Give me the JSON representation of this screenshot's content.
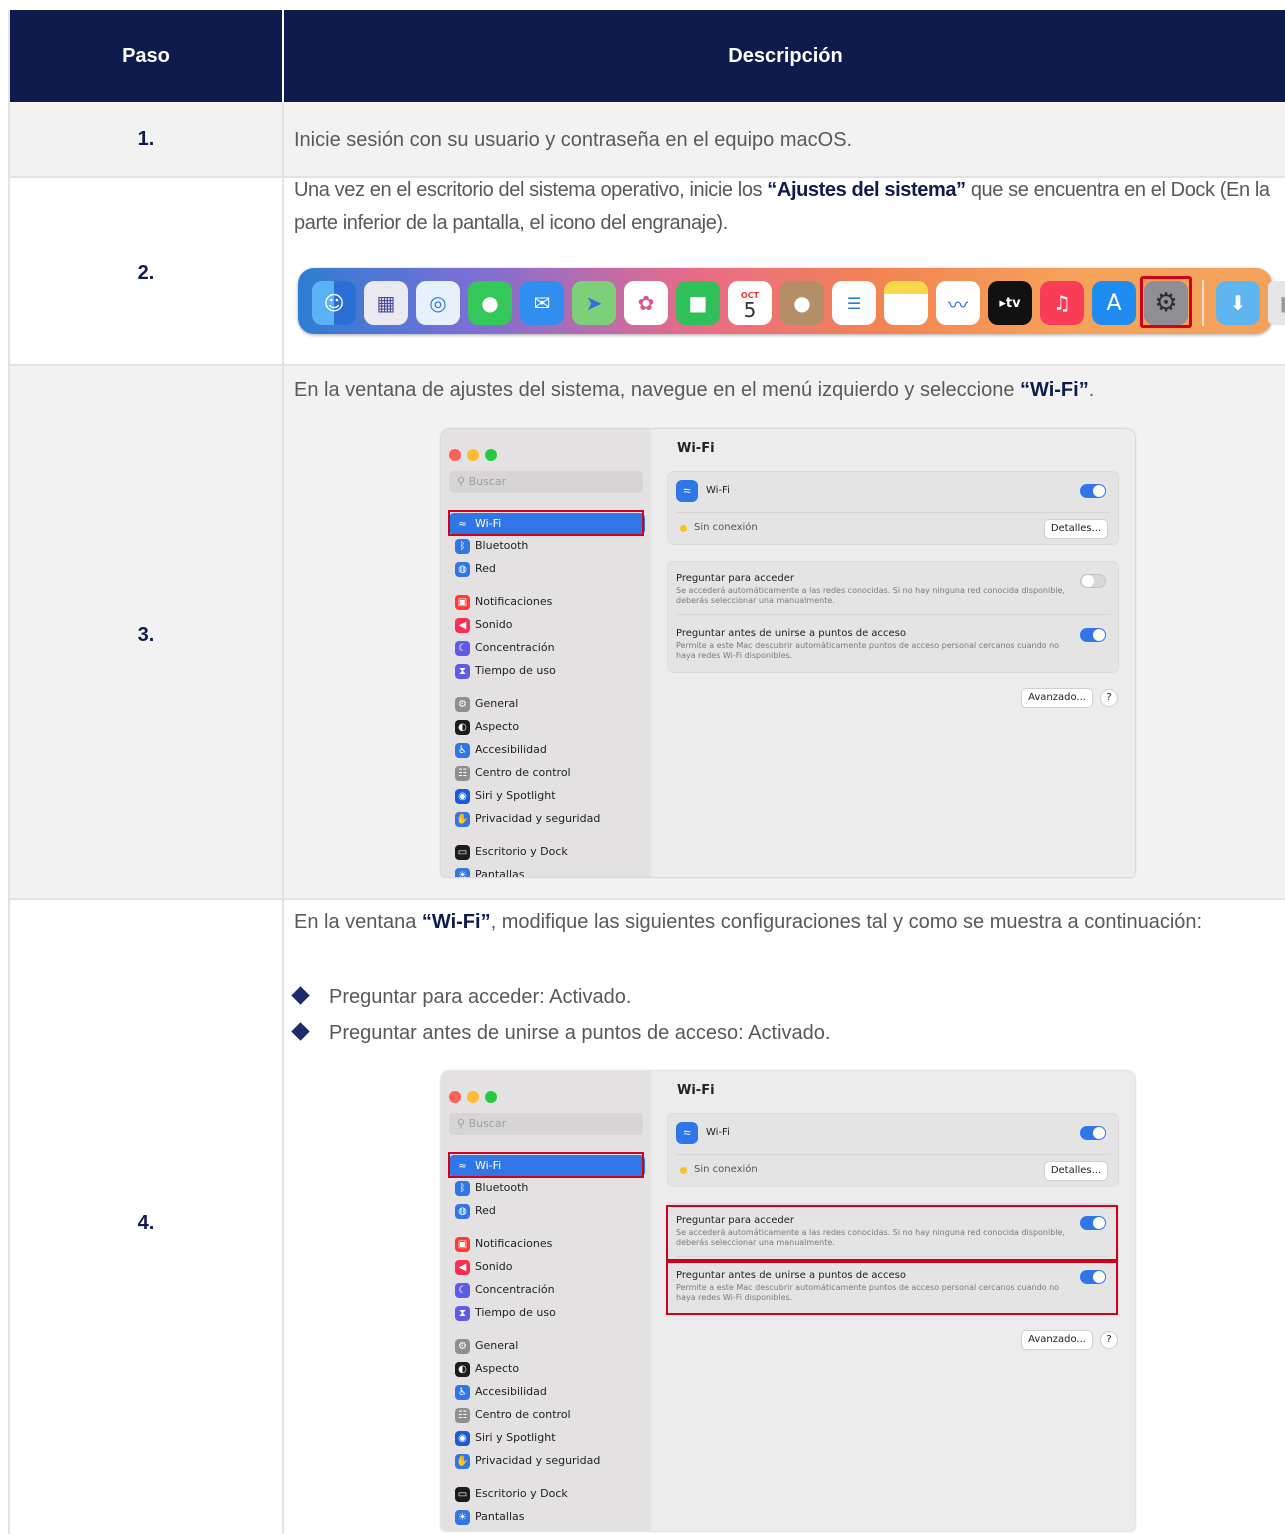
{
  "header": {
    "step": "Paso",
    "description": "Descripción"
  },
  "rows": [
    {
      "num": "1.",
      "text": "Inicie sesión con su usuario y contraseña en el equipo macOS."
    },
    {
      "num": "2.",
      "text_pre": "Una vez en el escritorio del sistema operativo, inicie los ",
      "bold": "“Ajustes del sistema”",
      "text_post": " que se encuentra en el Dock (En la parte inferior de la pantalla, el icono del engranaje)."
    },
    {
      "num": "3.",
      "text_pre": "En la ventana de ajustes del sistema, navegue en el menú izquierdo y seleccione ",
      "bold": "“Wi-Fi”",
      "text_post": "."
    },
    {
      "num": "4.",
      "text_pre": "En la ventana ",
      "bold": "“Wi-Fi”",
      "text_post": ", modifique las siguientes configuraciones tal y como se muestra a continuación:",
      "bullets": [
        "Preguntar para acceder: Activado.",
        "Preguntar antes de unirse a puntos de acceso: Activado."
      ]
    }
  ],
  "dock": {
    "icons": [
      "finder-icon",
      "launchpad-icon",
      "safari-icon",
      "messages-icon",
      "mail-icon",
      "maps-icon",
      "photos-icon",
      "facetime-icon",
      "calendar-icon",
      "contacts-icon",
      "reminders-icon",
      "notes-icon",
      "freeform-icon",
      "tv-icon",
      "music-icon",
      "appstore-icon",
      "system-settings-icon",
      "downloads-icon",
      "trash-icon"
    ],
    "calendar_month": "OCT",
    "calendar_day": "5",
    "tv_label": "tv"
  },
  "settings": {
    "search_placeholder": "Buscar",
    "sidebar": [
      "Wi-Fi",
      "Bluetooth",
      "Red",
      "Notificaciones",
      "Sonido",
      "Concentración",
      "Tiempo de uso",
      "General",
      "Aspecto",
      "Accesibilidad",
      "Centro de control",
      "Siri y Spotlight",
      "Privacidad y seguridad",
      "Escritorio y Dock",
      "Pantallas"
    ],
    "title": "Wi-Fi",
    "wifi_label": "Wi-Fi",
    "status": "Sin conexión",
    "details_button": "Detalles...",
    "ask_join_title": "Preguntar para acceder",
    "ask_join_desc": "Se accederá automáticamente a las redes conocidas. Si no hay ninguna red conocida disponible, deberás seleccionar una manualmente.",
    "ask_hotspot_title": "Preguntar antes de unirse a puntos de acceso",
    "ask_hotspot_desc": "Permite a este Mac descubrir automáticamente puntos de acceso personal cercanos cuando no haya redes Wi-Fi disponibles.",
    "advanced_button": "Avanzado...",
    "help_button": "?"
  },
  "colors": {
    "header_bg": "#0e1b4d",
    "accent_blue": "#3176e6",
    "highlight_red": "#d0021b"
  },
  "toggles": {
    "step3": {
      "wifi": true,
      "ask_join": false,
      "ask_hotspot": true
    },
    "step4": {
      "wifi": true,
      "ask_join": true,
      "ask_hotspot": true
    }
  }
}
